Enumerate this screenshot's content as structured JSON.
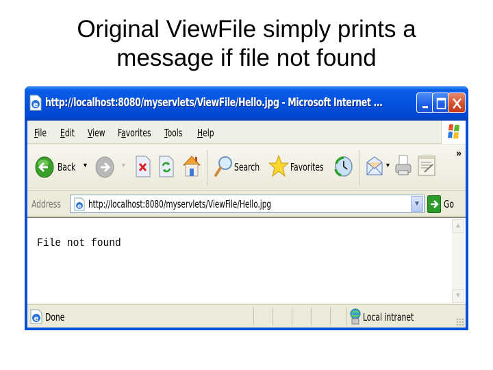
{
  "slide": {
    "title_line1": "Original ViewFile simply prints a",
    "title_line2": "message if file not found"
  },
  "window": {
    "title": "http://localhost:8080/myservlets/ViewFile/Hello.jpg - Microsoft Internet ...",
    "controls": {
      "minimize": "_",
      "maximize": "□",
      "close": "X"
    },
    "colors": {
      "titlebar": "#0451de",
      "close_button": "#d3502e",
      "chrome": "#ece9d8"
    }
  },
  "menubar": {
    "items": [
      {
        "label": "File",
        "accel": "F",
        "rest": "ile"
      },
      {
        "label": "Edit",
        "accel": "E",
        "rest": "dit"
      },
      {
        "label": "View",
        "accel": "V",
        "rest": "iew"
      },
      {
        "label": "Favorites",
        "pre": "F",
        "accel": "a",
        "rest": "vorites"
      },
      {
        "label": "Tools",
        "accel": "T",
        "rest": "ools"
      },
      {
        "label": "Help",
        "accel": "H",
        "rest": "elp"
      }
    ]
  },
  "toolbar": {
    "back_label": "Back",
    "search_label": "Search",
    "favorites_label": "Favorites",
    "overflow": "»",
    "icons": [
      "back-arrow",
      "forward-arrow",
      "stop",
      "refresh",
      "home",
      "search",
      "favorites-star",
      "history",
      "mail",
      "print",
      "edit"
    ]
  },
  "addressbar": {
    "label": "Address",
    "url": "http://localhost:8080/myservlets/ViewFile/Hello.jpg",
    "go_label": "Go"
  },
  "content": {
    "text": "File not found"
  },
  "statusbar": {
    "status": "Done",
    "zone": "Local intranet"
  }
}
